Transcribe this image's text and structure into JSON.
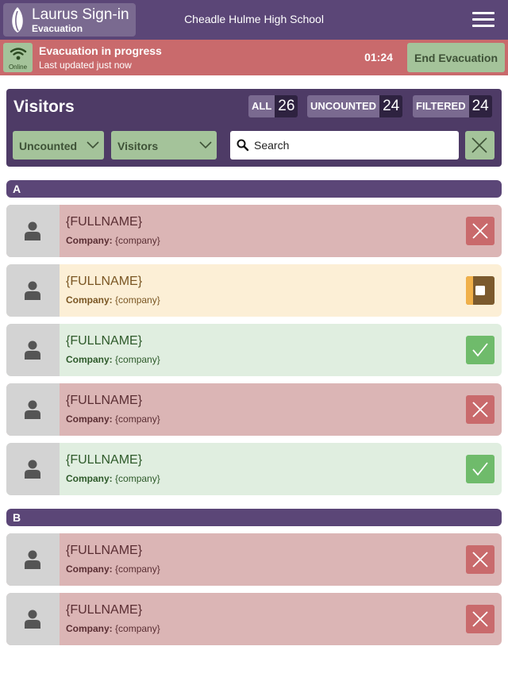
{
  "header": {
    "app_title": "Laurus Sign-in",
    "app_subtitle": "Evacuation",
    "school": "Cheadle Hulme High School"
  },
  "evac": {
    "online_label": "Online",
    "title": "Evacuation in progress",
    "updated": "Last updated just now",
    "timer": "01:24",
    "end_label": "End Evacuation"
  },
  "panel": {
    "title": "Visitors",
    "counters": [
      {
        "label": "ALL",
        "value": "26"
      },
      {
        "label": "UNCOUNTED",
        "value": "24"
      },
      {
        "label": "FILTERED",
        "value": "24"
      }
    ],
    "status_filter": "Uncounted",
    "type_filter": "Visitors",
    "search_placeholder": "Search"
  },
  "sections": [
    {
      "letter": "A",
      "rows": [
        {
          "name": "{FULLNAME}",
          "company_label": "Company:",
          "company": "{company}",
          "status": "red"
        },
        {
          "name": "{FULLNAME}",
          "company_label": "Company:",
          "company": "{company}",
          "status": "amber"
        },
        {
          "name": "{FULLNAME}",
          "company_label": "Company:",
          "company": "{company}",
          "status": "green"
        },
        {
          "name": "{FULLNAME}",
          "company_label": "Company:",
          "company": "{company}",
          "status": "red"
        },
        {
          "name": "{FULLNAME}",
          "company_label": "Company:",
          "company": "{company}",
          "status": "green"
        }
      ]
    },
    {
      "letter": "B",
      "rows": [
        {
          "name": "{FULLNAME}",
          "company_label": "Company:",
          "company": "{company}",
          "status": "red"
        },
        {
          "name": "{FULLNAME}",
          "company_label": "Company:",
          "company": "{company}",
          "status": "red"
        }
      ]
    }
  ],
  "colors": {
    "brand": "#5b4677",
    "alert": "#c96a6c",
    "accent": "#a4c39a",
    "uncounted": "#dbb5b5",
    "pending": "#fcefd6",
    "counted": "#e0eee0"
  }
}
